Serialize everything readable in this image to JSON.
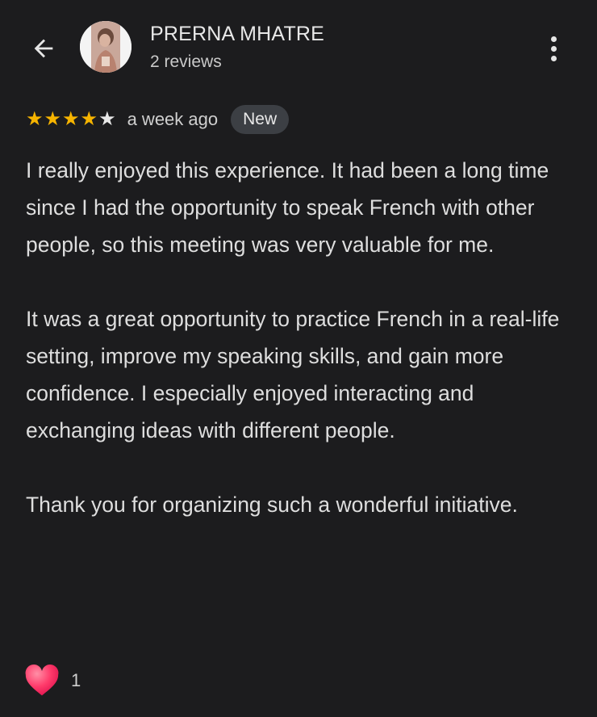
{
  "header": {
    "back_icon": "arrow-left-icon",
    "reviewer_name": "PRERNA MHATRE",
    "reviewer_meta": "2 reviews",
    "more_icon": "more-vert-icon"
  },
  "review": {
    "rating": 4,
    "rating_max": 5,
    "star_color": "#f6b400",
    "time_ago": "a week ago",
    "badge": "New",
    "paragraphs": [
      "I really enjoyed this experience. It had been a long time since I had the opportunity to speak French with other people, so this meeting was very valuable for me.",
      "It was a great opportunity to practice French in a real-life setting, improve my speaking skills, and gain more confidence. I especially enjoyed interacting and exchanging ideas with different people.",
      "Thank you for organizing such a wonderful initiative."
    ]
  },
  "reactions": {
    "icon": "heart-icon",
    "heart_color": "#ff3b6b",
    "count": "1"
  }
}
